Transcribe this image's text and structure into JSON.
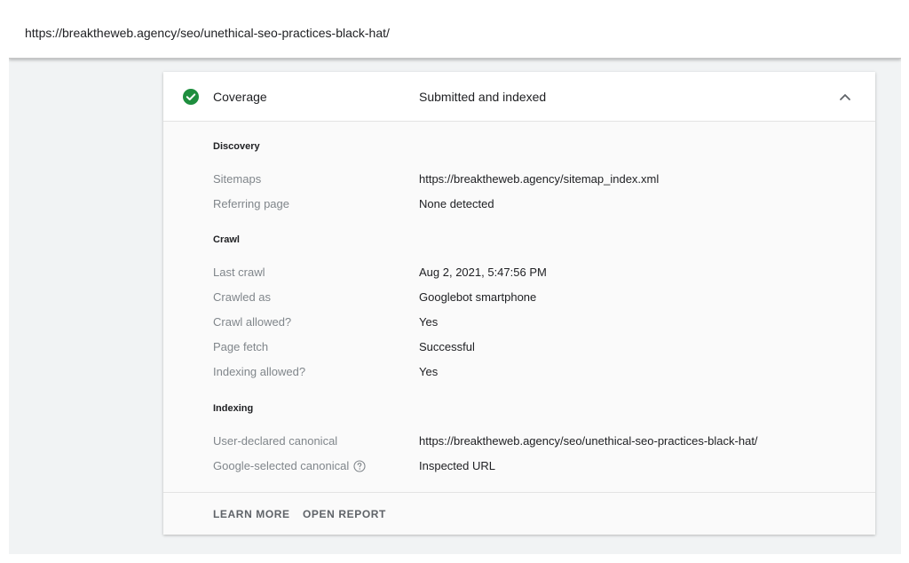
{
  "url_bar": {
    "url": "https://breaktheweb.agency/seo/unethical-seo-practices-black-hat/"
  },
  "card": {
    "header": {
      "label": "Coverage",
      "value": "Submitted and indexed",
      "status_icon": "check-circle-icon",
      "status_color": "#1e8e3e",
      "toggle_icon": "chevron-up-icon"
    },
    "sections": {
      "discovery": {
        "title": "Discovery",
        "rows": [
          {
            "label": "Sitemaps",
            "value": "https://breaktheweb.agency/sitemap_index.xml"
          },
          {
            "label": "Referring page",
            "value": "None detected"
          }
        ]
      },
      "crawl": {
        "title": "Crawl",
        "rows": [
          {
            "label": "Last crawl",
            "value": "Aug 2, 2021, 5:47:56 PM"
          },
          {
            "label": "Crawled as",
            "value": "Googlebot smartphone"
          },
          {
            "label": "Crawl allowed?",
            "value": "Yes"
          },
          {
            "label": "Page fetch",
            "value": "Successful"
          },
          {
            "label": "Indexing allowed?",
            "value": "Yes"
          }
        ]
      },
      "indexing": {
        "title": "Indexing",
        "rows": [
          {
            "label": "User-declared canonical",
            "value": "https://breaktheweb.agency/seo/unethical-seo-practices-black-hat/"
          },
          {
            "label": "Google-selected canonical",
            "value": "Inspected URL",
            "help_icon": "help-circle-icon"
          }
        ]
      }
    },
    "footer": {
      "learn_more": "LEARN MORE",
      "open_report": "OPEN REPORT"
    }
  }
}
